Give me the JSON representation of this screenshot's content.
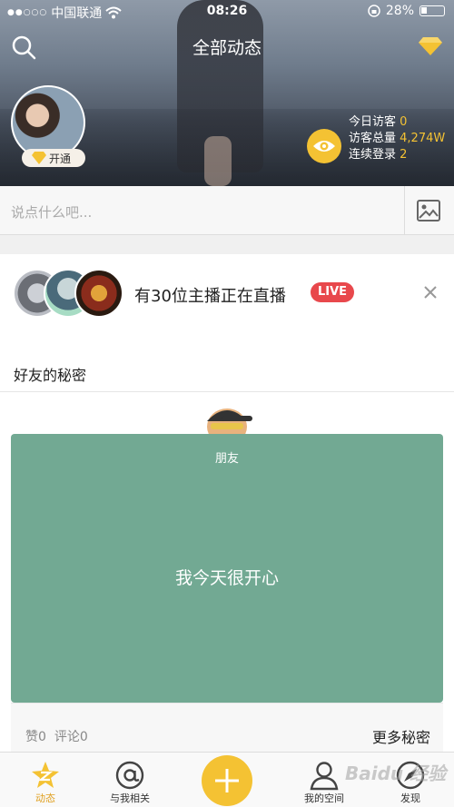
{
  "status_bar": {
    "signal": "●●○○○",
    "carrier": "中国联通",
    "time": "08:26",
    "battery": "28%"
  },
  "header": {
    "title": "全部动态",
    "open_badge": "开通"
  },
  "visitors": {
    "today_label": "今日访客",
    "today_value": "0",
    "total_label": "访客总量",
    "total_value": "4,274W",
    "login_label": "连续登录",
    "login_value": "2"
  },
  "post": {
    "placeholder": "说点什么吧..."
  },
  "live": {
    "text": "有30位主播正在直播",
    "badge": "LIVE"
  },
  "friends_secret": {
    "section_title": "好友的秘密",
    "tag": "朋友",
    "message": "我今天很开心",
    "likes": "赞0",
    "comments": "评论0",
    "more": "更多秘密"
  },
  "tabs": [
    {
      "label": "动态",
      "icon": "feed-star-icon",
      "active": true
    },
    {
      "label": "与我相关",
      "icon": "at-icon"
    },
    {
      "label": "",
      "icon": "plus-icon"
    },
    {
      "label": "我的空间",
      "icon": "person-icon"
    },
    {
      "label": "发现",
      "icon": "compass-icon"
    }
  ],
  "colors": {
    "accent": "#f4c233",
    "live": "#e8484c",
    "card": "#72a993"
  },
  "watermark": "Baidu 经验"
}
